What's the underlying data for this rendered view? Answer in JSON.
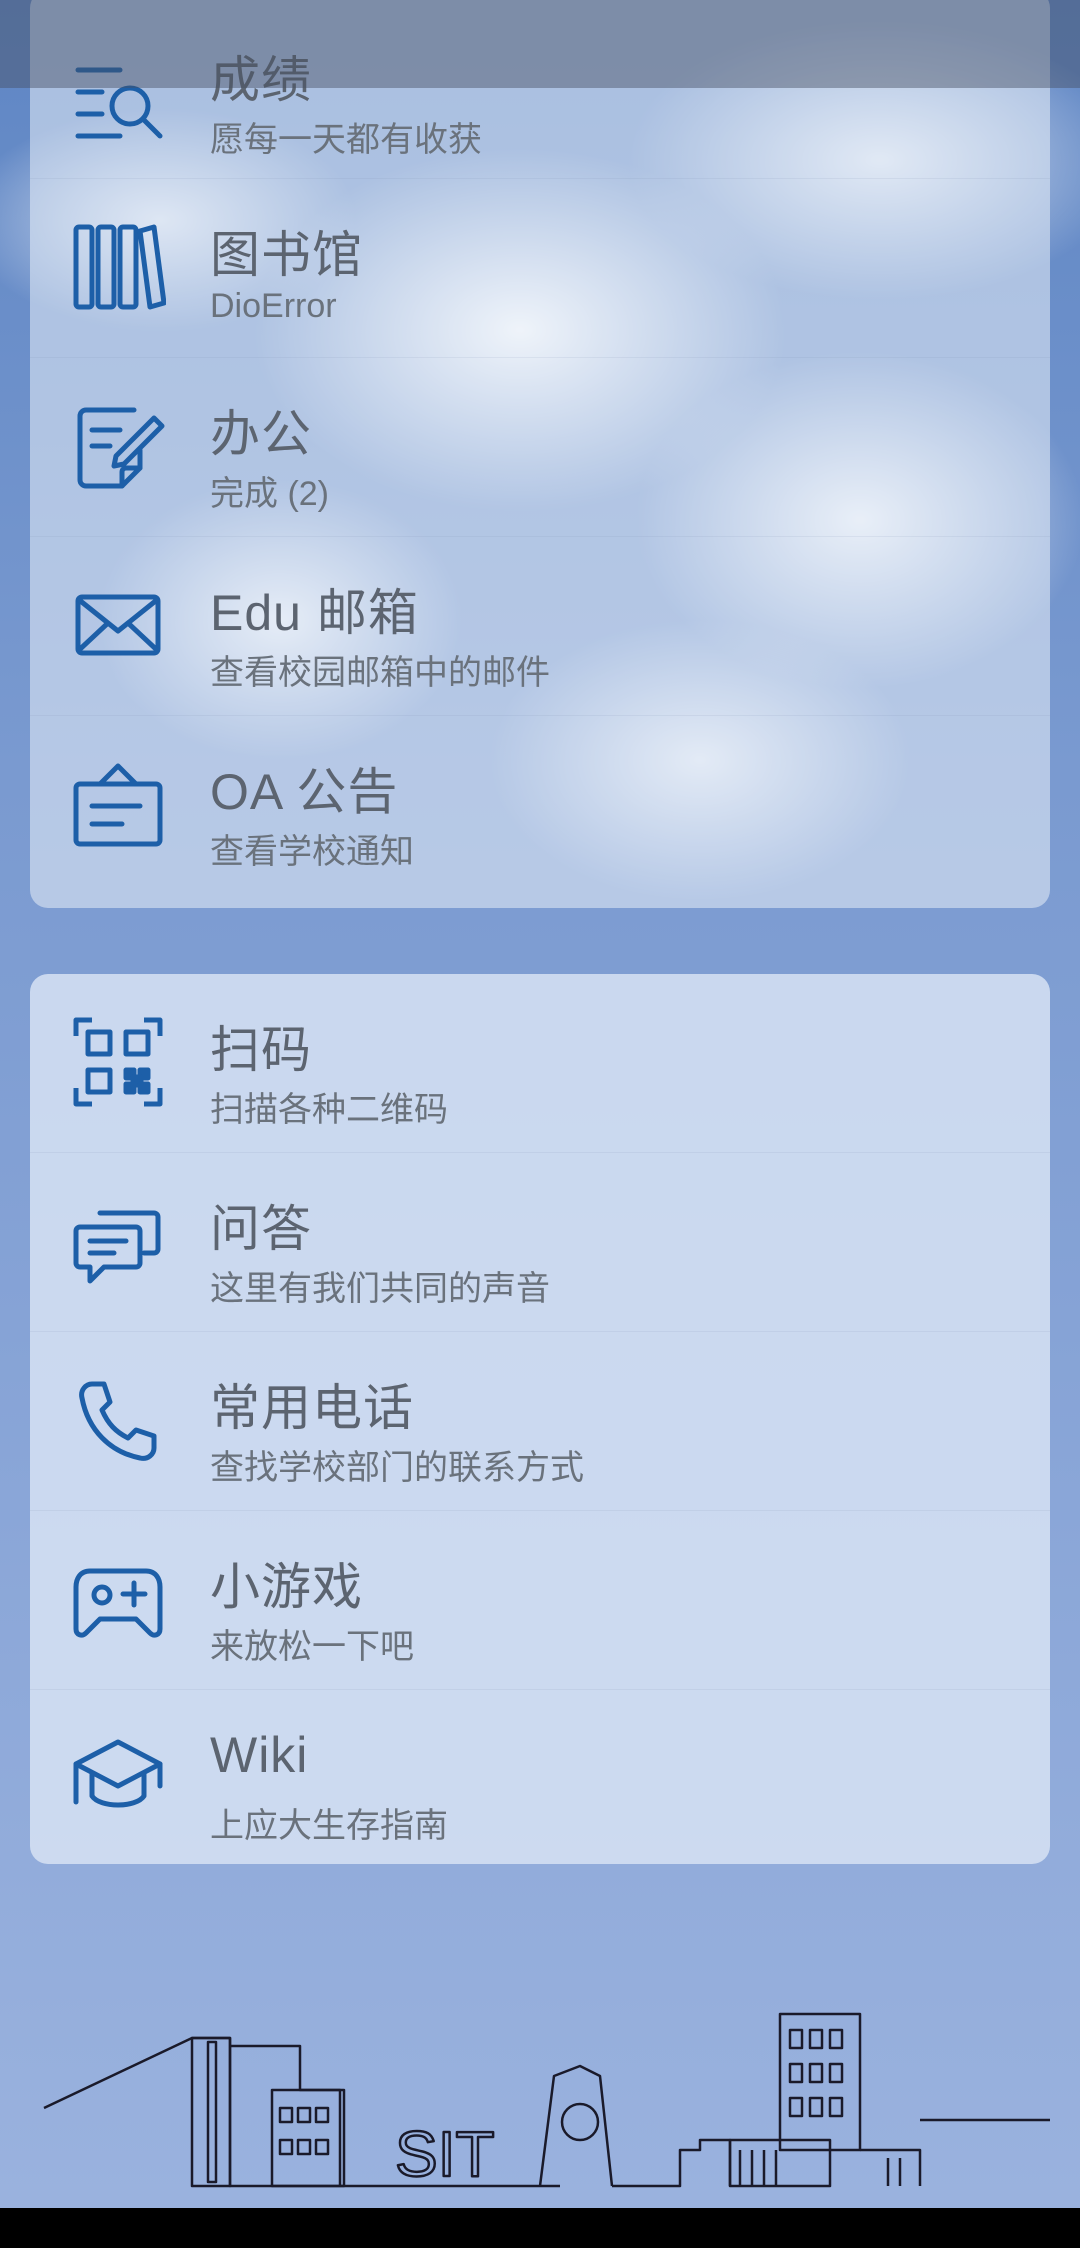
{
  "card1": {
    "items": [
      {
        "icon": "grades-search-icon",
        "title": "成绩",
        "subtitle": "愿每一天都有收获"
      },
      {
        "icon": "library-books-icon",
        "title": "图书馆",
        "subtitle": "DioError"
      },
      {
        "icon": "office-edit-icon",
        "title": "办公",
        "subtitle": "完成 (2)"
      },
      {
        "icon": "mail-icon",
        "title": "Edu 邮箱",
        "subtitle": "查看校园邮箱中的邮件"
      },
      {
        "icon": "announcement-board-icon",
        "title": "OA 公告",
        "subtitle": "查看学校通知"
      }
    ]
  },
  "card2": {
    "items": [
      {
        "icon": "qr-scan-icon",
        "title": "扫码",
        "subtitle": "扫描各种二维码"
      },
      {
        "icon": "chat-bubbles-icon",
        "title": "问答",
        "subtitle": "这里有我们共同的声音"
      },
      {
        "icon": "phone-icon",
        "title": "常用电话",
        "subtitle": "查找学校部门的联系方式"
      },
      {
        "icon": "gamepad-icon",
        "title": "小游戏",
        "subtitle": "来放松一下吧"
      },
      {
        "icon": "graduation-cap-icon",
        "title": "Wiki",
        "subtitle": "上应大生存指南"
      }
    ]
  },
  "footer": {
    "skyline_text": "SIT"
  },
  "colors": {
    "icon": "#1d5fa8",
    "title": "#5c6470",
    "subtitle": "#6a727c"
  }
}
